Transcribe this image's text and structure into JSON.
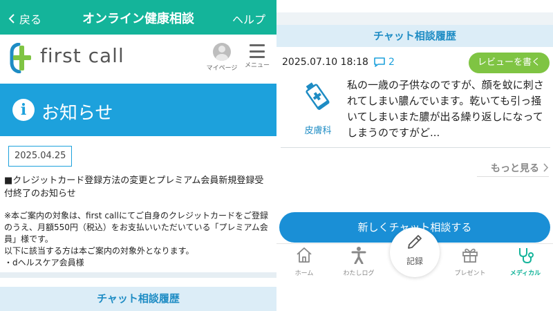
{
  "left": {
    "header": {
      "back_label": "戻る",
      "title": "オンライン健康相談",
      "help_label": "ヘルプ"
    },
    "brand": {
      "logo_text": "first call",
      "mypage_label": "マイページ",
      "menu_label": "メニュー"
    },
    "notice": {
      "banner_title": "お知らせ",
      "date": "2025.04.25",
      "title": "■クレジットカード登録方法の変更とプレミアム会員新規登録受付終了のお知らせ",
      "body_line1": "※本ご案内の対象は、first callにてご自身のクレジットカードをご登録のうえ、月額550円（税込）をお支払いいただいている「プレミアム会員」様です。",
      "body_line2": "以下に該当する方は本ご案内の対象外となります。",
      "body_line3": "・dヘルスケア会員様"
    },
    "section_title": "チャット相談履歴"
  },
  "right": {
    "section_title": "チャット相談履歴",
    "card": {
      "datetime": "2025.07.10 18:18",
      "comment_count": "2",
      "review_label": "レビューを書く",
      "department": "皮膚科",
      "text": "私の一歳の子供なのですが、顔を蚊に刺されてしまい膿んでいます。乾いても引っ掻いてしまいまた膿が出る繰り返しになってしまうのですがど..."
    },
    "more_label": "もっと見る",
    "new_chat_label": "新しくチャット相談する",
    "nav": {
      "home": "ホーム",
      "log": "わたしログ",
      "record": "記録",
      "present": "プレゼント",
      "medical": "メディカル"
    }
  },
  "colors": {
    "header_green": "#14b49a",
    "banner_blue": "#1da1dc",
    "section_bg": "#dcedf7",
    "section_text": "#1e8cc4",
    "review_green": "#7fc443",
    "button_blue": "#1a8fd6"
  },
  "icons": {
    "back": "chevron-left-icon",
    "logo": "first-call-logo-icon",
    "avatar": "avatar-icon",
    "menu": "hamburger-menu-icon",
    "info": "info-icon",
    "comment": "speech-bubble-icon",
    "department": "ointment-tube-icon",
    "more": "chevron-right-icon",
    "home": "home-icon",
    "log": "person-icon",
    "record": "pencil-icon",
    "present": "gift-icon",
    "medical": "stethoscope-icon"
  }
}
